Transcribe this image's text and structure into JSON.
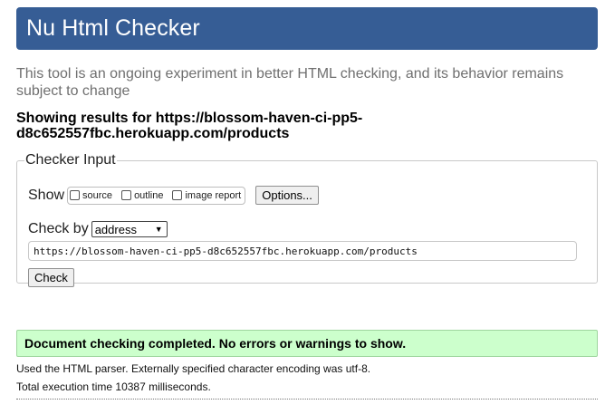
{
  "header": {
    "title": "Nu Html Checker"
  },
  "intro": "This tool is an ongoing experiment in better HTML checking, and its behavior remains subject to change",
  "showing_results": "Showing results for https://blossom-haven-ci-pp5-d8c652557fbc.herokuapp.com/products",
  "checker_input": {
    "legend": "Checker Input",
    "show_label": "Show",
    "show_options": [
      {
        "label": "source",
        "checked": false
      },
      {
        "label": "outline",
        "checked": false
      },
      {
        "label": "image report",
        "checked": false
      }
    ],
    "options_button": "Options...",
    "check_by_label": "Check by",
    "check_by_value": "address",
    "url": "https://blossom-haven-ci-pp5-d8c652557fbc.herokuapp.com/products",
    "check_button": "Check"
  },
  "result": {
    "message": "Document checking completed. No errors or warnings to show.",
    "parser_info": "Used the HTML parser. Externally specified character encoding was utf-8.",
    "execution_time": "Total execution time 10387 milliseconds."
  },
  "colors": {
    "header_bg": "#365d95",
    "success_bg": "#ccffcc"
  }
}
